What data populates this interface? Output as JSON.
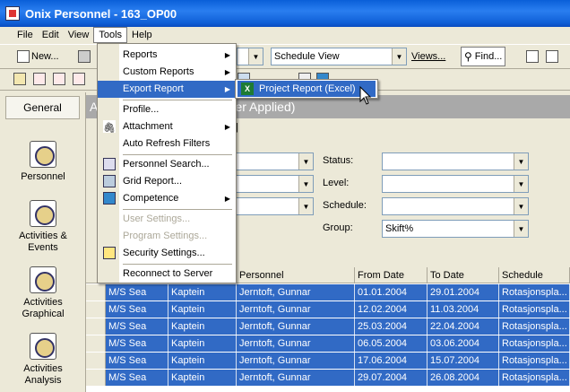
{
  "window": {
    "title": "Onix Personnel - 163_OP00"
  },
  "menubar": [
    "File",
    "Edit",
    "View",
    "Tools",
    "Help"
  ],
  "toolbar": {
    "new_label": "New...",
    "view_combo": "Schedule View",
    "views_label": "Views...",
    "find_label": "Find..."
  },
  "sidebar": {
    "header": "General",
    "items": [
      "Personnel",
      "Activities & Events",
      "Activities Graphical",
      "Activities Analysis"
    ]
  },
  "banner": {
    "text": "A",
    "suffix": "er Applied)"
  },
  "filters": {
    "status_label": "Status:",
    "status_value": "",
    "level_label": "Level:",
    "level_value": "",
    "schedule_label": "Schedule:",
    "schedule_value": "",
    "group_label": "Group:",
    "group_value": "Skift%"
  },
  "tools_menu": {
    "items": [
      {
        "label": "Reports",
        "sub": true
      },
      {
        "label": "Custom Reports",
        "sub": true
      },
      {
        "label": "Export Report",
        "sub": true,
        "selected": true
      },
      {
        "label": "Profile..."
      },
      {
        "label": "Attachment",
        "sub": true
      },
      {
        "label": "Auto Refresh Filters"
      },
      {
        "label": "Personnel Search..."
      },
      {
        "label": "Grid Report..."
      },
      {
        "label": "Competence",
        "sub": true
      },
      {
        "label": "User Settings...",
        "disabled": true
      },
      {
        "label": "Program Settings...",
        "disabled": true
      },
      {
        "label": "Security Settings..."
      },
      {
        "label": "Reconnect to Server"
      }
    ]
  },
  "export_submenu": {
    "item": "Project Report (Excel)"
  },
  "grid": {
    "columns": [
      "Personnel",
      "From Date",
      "To Date",
      "Schedule"
    ],
    "rows": [
      [
        "M/S Sea",
        "Kaptein",
        "Jerntoft, Gunnar",
        "01.01.2004",
        "29.01.2004",
        "Rotasjonspla..."
      ],
      [
        "M/S Sea",
        "Kaptein",
        "Jerntoft, Gunnar",
        "12.02.2004",
        "11.03.2004",
        "Rotasjonspla..."
      ],
      [
        "M/S Sea",
        "Kaptein",
        "Jerntoft, Gunnar",
        "25.03.2004",
        "22.04.2004",
        "Rotasjonspla..."
      ],
      [
        "M/S Sea",
        "Kaptein",
        "Jerntoft, Gunnar",
        "06.05.2004",
        "03.06.2004",
        "Rotasjonspla..."
      ],
      [
        "M/S Sea",
        "Kaptein",
        "Jerntoft, Gunnar",
        "17.06.2004",
        "15.07.2004",
        "Rotasjonspla..."
      ],
      [
        "M/S Sea",
        "Kaptein",
        "Jerntoft, Gunnar",
        "29.07.2004",
        "26.08.2004",
        "Rotasjonspla..."
      ]
    ]
  }
}
